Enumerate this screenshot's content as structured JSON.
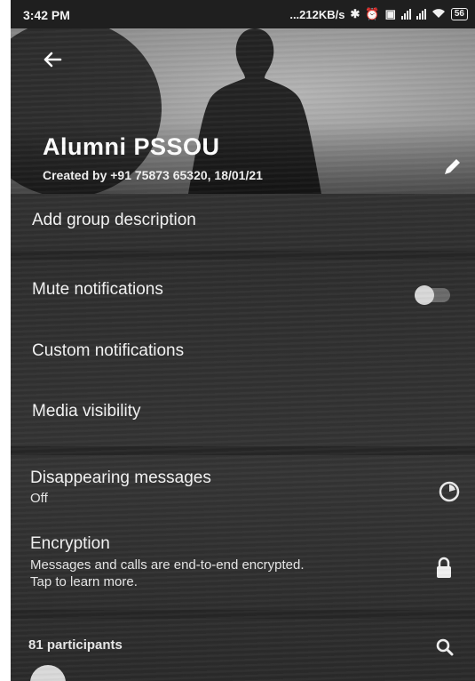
{
  "status_bar": {
    "time": "3:42 PM",
    "net_speed": "...212KB/s",
    "battery": "56",
    "icons": [
      "bluetooth-icon",
      "alarm-icon",
      "data-icon",
      "signal-icon",
      "signal-icon",
      "wifi-icon",
      "battery-icon"
    ]
  },
  "header": {
    "group_name": "Alumni PSSOU",
    "created_by": "Created by +91 75873 65320, 18/01/21",
    "back_icon": "arrow-left-icon",
    "edit_icon": "pencil-icon"
  },
  "settings": {
    "add_description": "Add group description",
    "mute_notifications": "Mute notifications",
    "mute_enabled": false,
    "custom_notifications": "Custom notifications",
    "media_visibility": "Media visibility",
    "disappearing_messages": {
      "title": "Disappearing messages",
      "value": "Off"
    },
    "encryption": {
      "title": "Encryption",
      "line1": "Messages and calls are end-to-end encrypted.",
      "line2": "Tap to learn more."
    }
  },
  "participants": {
    "label": "81 participants",
    "search_icon": "search-icon"
  }
}
